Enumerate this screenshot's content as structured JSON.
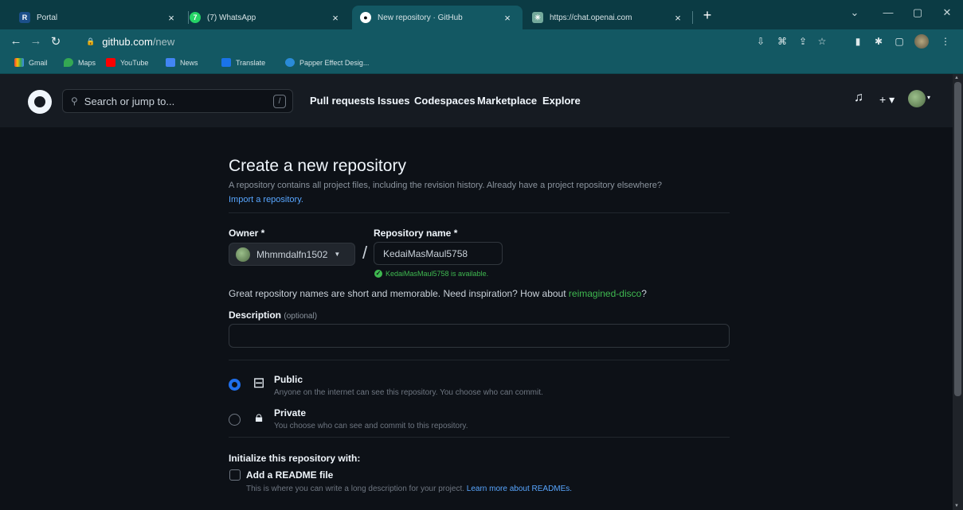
{
  "browser": {
    "tabs": [
      {
        "title": "Portal",
        "close": "×"
      },
      {
        "title": "(7) WhatsApp",
        "close": "×"
      },
      {
        "title": "New repository · GitHub",
        "close": "×"
      },
      {
        "title": "https://chat.openai.com",
        "close": "×"
      }
    ],
    "new_tab": "+",
    "window_controls": [
      "⌄",
      "—",
      "▢",
      "✕"
    ],
    "url_host": "github.com",
    "url_path": "/new",
    "bookmarks": [
      "Gmail",
      "Maps",
      "YouTube",
      "News",
      "Translate",
      "Papper Effect Desig..."
    ]
  },
  "github_header": {
    "search_placeholder": "Search or jump to...",
    "search_shortcut": "/",
    "nav": [
      "Pull requests",
      "Issues",
      "Codespaces",
      "Marketplace",
      "Explore"
    ],
    "plus": "+ ▾"
  },
  "form": {
    "title": "Create a new repository",
    "subtitle": "A repository contains all project files, including the revision history. Already have a project repository elsewhere?",
    "import_link": "Import a repository.",
    "owner_label": "Owner *",
    "owner_value": "Mhmmdalfn1502",
    "slash": "/",
    "repo_label": "Repository name *",
    "repo_value": "KedaiMasMaul5758",
    "availability": "KedaiMasMaul5758 is available.",
    "hint_prefix": "Great repository names are short and memorable. Need inspiration? How about",
    "hint_suggestion": "reimagined-disco",
    "hint_suffix": "?",
    "description_label": "Description",
    "description_optional": "(optional)",
    "description_value": "",
    "visibility": [
      {
        "title": "Public",
        "desc": "Anyone on the internet can see this repository. You choose who can commit.",
        "selected": true
      },
      {
        "title": "Private",
        "desc": "You choose who can see and commit to this repository.",
        "selected": false
      }
    ],
    "init_title": "Initialize this repository with:",
    "readme_label": "Add a README file",
    "readme_desc": "This is where you can write a long description for your project.",
    "readme_link": "Learn more about READMEs."
  },
  "colors": {
    "bg": "#0d1117",
    "header": "#161b22",
    "link": "#58a6ff",
    "success": "#3fb950",
    "radio_selected": "#1f6feb"
  }
}
